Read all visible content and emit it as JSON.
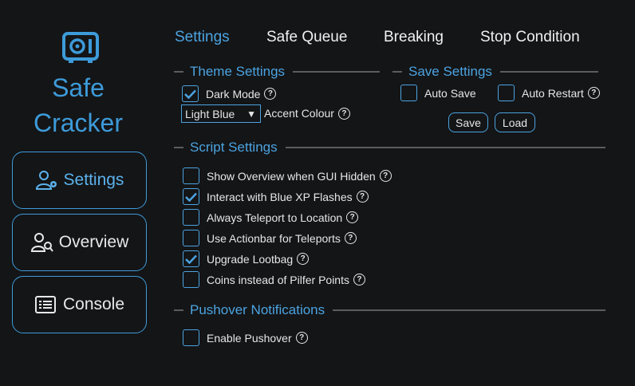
{
  "app": {
    "title_line1": "Safe",
    "title_line2": "Cracker",
    "accent": "#3d9bd9"
  },
  "sidebar": {
    "items": [
      {
        "label": "Settings",
        "icon": "user-gear-icon"
      },
      {
        "label": "Overview",
        "icon": "user-search-icon"
      },
      {
        "label": "Console",
        "icon": "list-icon"
      }
    ]
  },
  "tabs": [
    {
      "label": "Settings"
    },
    {
      "label": "Safe Queue"
    },
    {
      "label": "Breaking"
    },
    {
      "label": "Stop Condition"
    }
  ],
  "theme_settings": {
    "title": "Theme Settings",
    "dark_mode": {
      "label": "Dark Mode",
      "checked": true
    },
    "accent_select": {
      "value": "Light Blue"
    },
    "accent_label": "Accent Colour"
  },
  "save_settings": {
    "title": "Save Settings",
    "auto_save": {
      "label": "Auto Save",
      "checked": false
    },
    "auto_restart": {
      "label": "Auto Restart",
      "checked": false
    },
    "save_label": "Save",
    "load_label": "Load"
  },
  "script_settings": {
    "title": "Script Settings",
    "options": [
      {
        "label": "Show Overview when GUI Hidden",
        "checked": false
      },
      {
        "label": "Interact with Blue XP Flashes",
        "checked": true
      },
      {
        "label": "Always Teleport to Location",
        "checked": false
      },
      {
        "label": "Use Actionbar for Teleports",
        "checked": false
      },
      {
        "label": "Upgrade Lootbag",
        "checked": true
      },
      {
        "label": "Coins instead of Pilfer Points",
        "checked": false
      }
    ]
  },
  "pushover": {
    "title": "Pushover Notifications",
    "enable": {
      "label": "Enable Pushover",
      "checked": false
    }
  },
  "help_glyph": "?"
}
